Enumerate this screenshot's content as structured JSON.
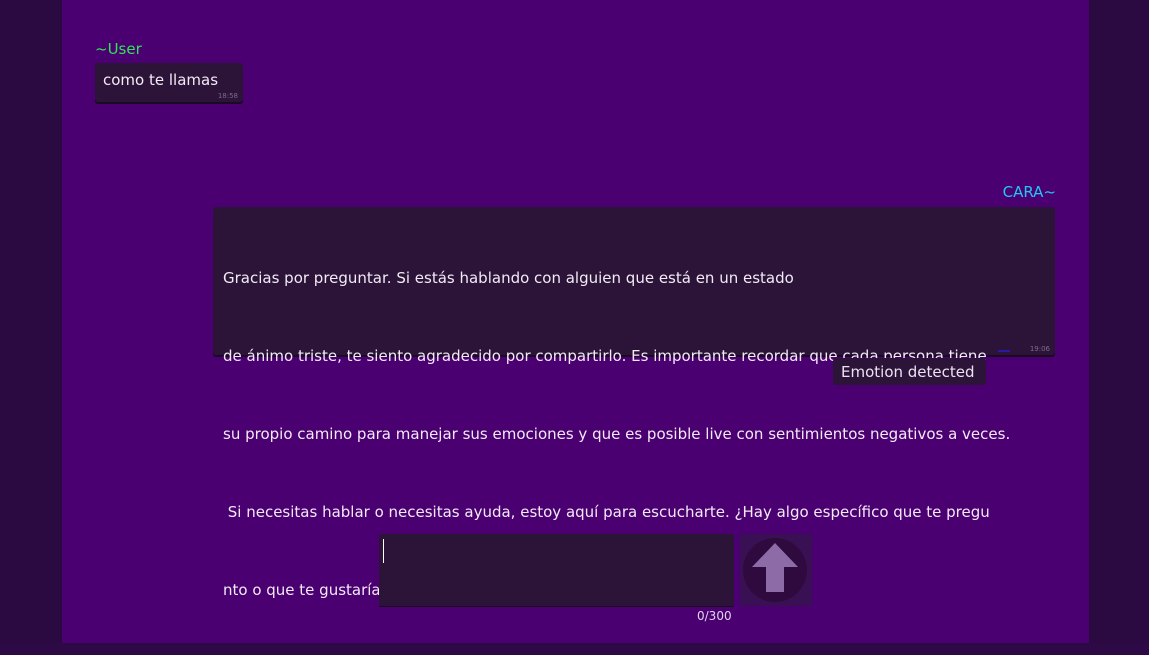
{
  "messages": {
    "user": {
      "sender": "~User",
      "text": "como te llamas",
      "time": "18:58"
    },
    "bot": {
      "sender": "CARA~",
      "lines": [
        "Gracias por preguntar. Si estás hablando con alguien que está en un estado",
        "de ánimo triste, te siento agradecido por compartirlo. Es importante recordar que cada persona tiene",
        "su propio camino para manejar sus emociones y que es posible live con sentimientos negativos a veces.",
        " Si necesitas hablar o necesitas ayuda, estoy aquí para escucharte. ¿Hay algo específico que te pregu",
        "nto o que te gustaría talkarle?"
      ],
      "time": "19:06"
    }
  },
  "emotion_button": {
    "label": "Emotion detected"
  },
  "composer": {
    "value": "",
    "counter": "0/300"
  },
  "colors": {
    "user_name": "#33e05a",
    "bot_name": "#27c5f5",
    "background": "#4a0070",
    "bubble": "#2c1438"
  },
  "icons": {
    "send": "up-arrow-icon"
  }
}
